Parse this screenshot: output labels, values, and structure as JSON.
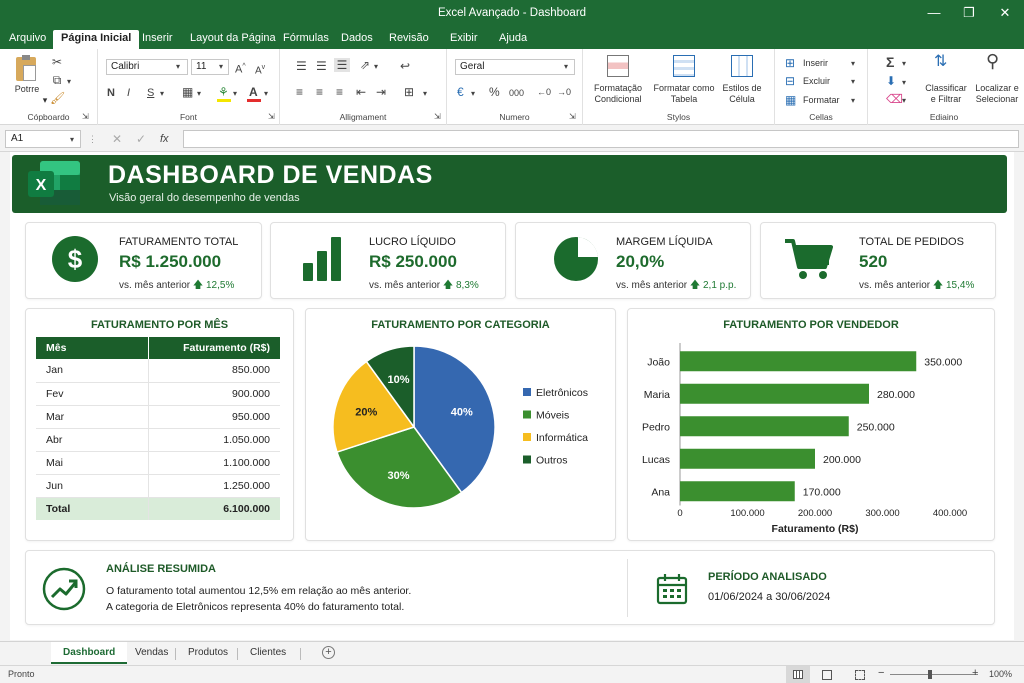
{
  "window": {
    "title": "Excel Avançado - Dashboard"
  },
  "menu_tabs": [
    "Arquivo",
    "Página Inicial",
    "Inserir",
    "Layout da Página",
    "Fórmulas",
    "Dados",
    "Revisão",
    "Exibir",
    "Ajuda"
  ],
  "ribbon": {
    "clipboard": {
      "paste": "Potrre",
      "label": "Cópboardo"
    },
    "font": {
      "name": "Calibri",
      "size": "11",
      "bold": "N",
      "italic": "I",
      "underline": "S",
      "label": "Font"
    },
    "alignment": {
      "label": "Alligmament"
    },
    "number": {
      "format": "Geral",
      "percent": "%",
      "thousands": "000",
      "label": "Numero"
    },
    "styles": {
      "cond_format": "Formatação Condicional",
      "format_table": "Formatar como Tabela",
      "cell_styles": "Estilos de Célula",
      "label": "Stylos"
    },
    "cells": {
      "insert": "Inserir",
      "delete": "Excluir",
      "format": "Formatar",
      "label": "Cellas"
    },
    "editing": {
      "sort": "Classificar e Filtrar",
      "find": "Localizar e Selecionar",
      "label": "Ediaino"
    }
  },
  "formula_bar": {
    "cell": "A1",
    "fx": "fx",
    "content": ""
  },
  "dashboard": {
    "title": "DASHBOARD DE VENDAS",
    "subtitle": "Visão geral do desempenho de vendas",
    "kpis": [
      {
        "label": "FATURAMENTO TOTAL",
        "value": "R$ 1.250.000",
        "comp_text": "vs. mês anterior",
        "change": "12,5%",
        "icon": "dollar-icon"
      },
      {
        "label": "LUCRO LÍQUIDO",
        "value": "R$ 250.000",
        "comp_text": "vs. mês anterior",
        "change": "8,3%",
        "icon": "bar-chart-icon"
      },
      {
        "label": "MARGEM LÍQUIDA",
        "value": "20,0%",
        "comp_text": "vs. mês anterior",
        "change": "2,1 p.p.",
        "icon": "pie-chart-icon"
      },
      {
        "label": "TOTAL DE PEDIDOS",
        "value": "520",
        "comp_text": "vs. mês anterior",
        "change": "15,4%",
        "icon": "cart-icon"
      }
    ],
    "monthly": {
      "title": "FATURAMENTO POR MÊS",
      "headers": [
        "Mês",
        "Faturamento (R$)"
      ],
      "rows": [
        [
          "Jan",
          "850.000"
        ],
        [
          "Fev",
          "900.000"
        ],
        [
          "Mar",
          "950.000"
        ],
        [
          "Abr",
          "1.050.000"
        ],
        [
          "Mai",
          "1.100.000"
        ],
        [
          "Jun",
          "1.250.000"
        ]
      ],
      "total": [
        "Total",
        "6.100.000"
      ]
    },
    "analysis": {
      "title": "ANÁLISE RESUMIDA",
      "line1": "O faturamento total aumentou 12,5% em relação ao mês anterior.",
      "line2": "A categoria de Eletrônicos representa 40% do faturamento total."
    },
    "period": {
      "title": "PERÍODO ANALISADO",
      "value": "01/06/2024 a 30/06/2024"
    }
  },
  "chart_data": [
    {
      "type": "pie",
      "title": "FATURAMENTO POR CATEGORIA",
      "categories": [
        "Eletrônicos",
        "Móveis",
        "Informática",
        "Outros"
      ],
      "values": [
        40,
        30,
        20,
        10
      ],
      "labels": [
        "40%",
        "30%",
        "20%",
        "10%"
      ],
      "colors": [
        "#3568b0",
        "#3b8f2f",
        "#f6bd1f",
        "#1b5e2a"
      ],
      "legend": "right"
    },
    {
      "type": "bar",
      "orientation": "horizontal",
      "title": "FATURAMENTO POR VENDEDOR",
      "categories": [
        "João",
        "Maria",
        "Pedro",
        "Lucas",
        "Ana"
      ],
      "values": [
        350000,
        280000,
        250000,
        200000,
        170000
      ],
      "value_labels": [
        "350.000",
        "280.000",
        "250.000",
        "200.000",
        "170.000"
      ],
      "xlabel": "Faturamento (R$)",
      "xlim": [
        0,
        400000
      ],
      "ticks": [
        "0",
        "100.000",
        "200.000",
        "300.000",
        "400.000"
      ],
      "color": "#3b8f2f"
    }
  ],
  "sheet_tabs": [
    "Dashboard",
    "Vendas",
    "Produtos",
    "Clientes"
  ],
  "status": {
    "left": "Pronto",
    "zoom": "100%"
  },
  "colors": {
    "brand": "#1e6b34",
    "dark": "#1b5e2a",
    "accent": "#3b8f2f"
  }
}
